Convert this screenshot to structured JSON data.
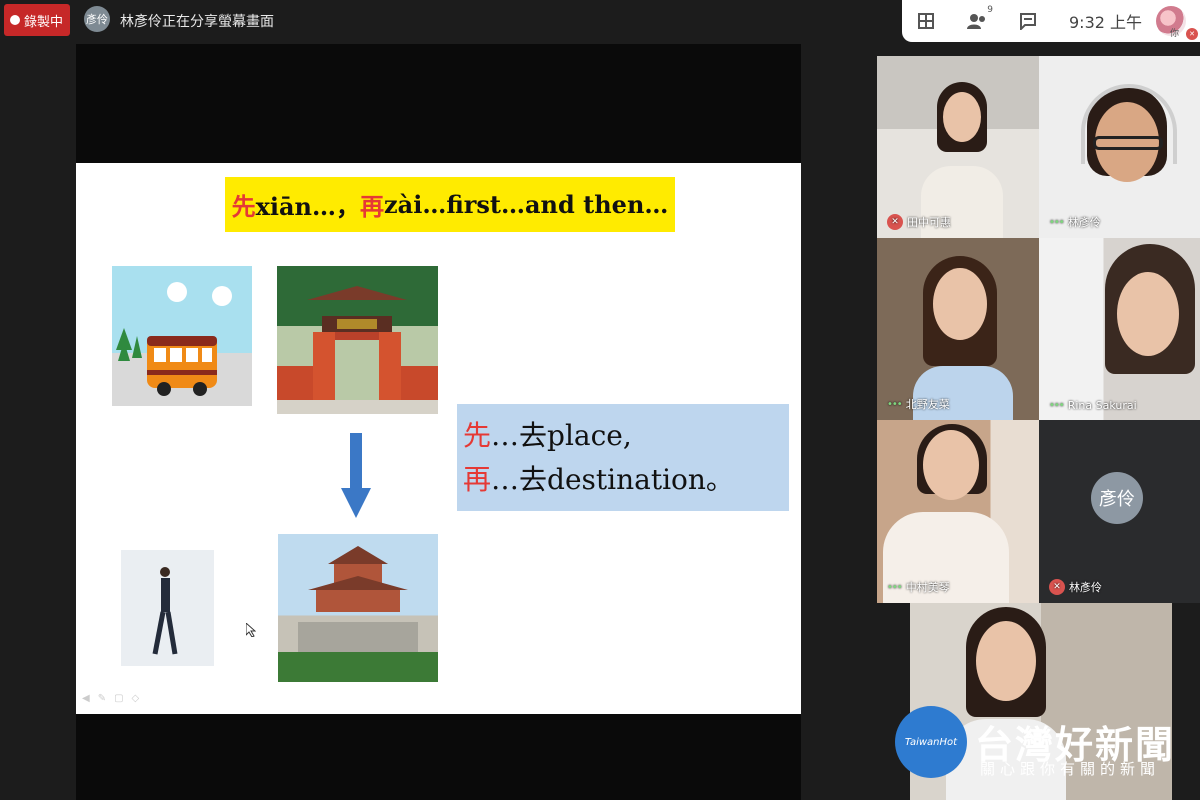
{
  "top": {
    "recording_label": "錄製中",
    "presenter_avatar": "彥伶",
    "sharing_text": "林彥伶正在分享螢幕畫面"
  },
  "toolbar": {
    "icons": [
      "grid-layout-icon",
      "participants-icon",
      "chat-icon"
    ],
    "participants_count": "9",
    "time": "9:32 上午",
    "me_label": "你"
  },
  "slide": {
    "title_red1": "先",
    "title_part1": "xiān…，",
    "title_red2": "再",
    "title_part2": "zài…first…and then…",
    "line1_red": "先",
    "line1_rest": "…去place,",
    "line2_red": "再",
    "line2_rest": "…去destination。"
  },
  "participants": [
    {
      "name": "田中可惠",
      "muted": true
    },
    {
      "name": "林彥伶",
      "muted": false
    },
    {
      "name": "北野友菜",
      "muted": false
    },
    {
      "name": "Rina Sakurai",
      "muted": false
    },
    {
      "name": "中村美琴",
      "muted": false
    },
    {
      "name": "林彥伶",
      "muted": true,
      "avatar": "彥伶"
    },
    {
      "name": "",
      "muted": false
    }
  ],
  "watermark": {
    "logo": "TaiwanHot",
    "title": "台灣好新聞",
    "subtitle": "關心跟你有關的新聞"
  },
  "colors": {
    "accent_red": "#e53935",
    "title_yellow": "#ffeb00",
    "note_blue": "#bed6ee",
    "arrow_blue": "#3b78c6"
  }
}
